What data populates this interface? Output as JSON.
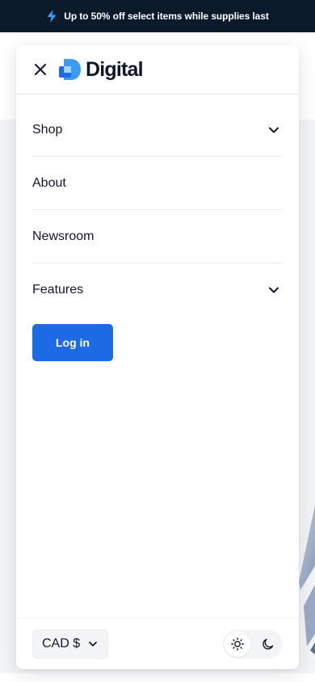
{
  "promo": {
    "icon": "lightning-bolt-icon",
    "text": "Up to 50% off select items while supplies last"
  },
  "header": {
    "brand": "Digital",
    "close_icon": "close-icon",
    "logo_icon": "digital-logo-icon"
  },
  "nav": {
    "items": [
      {
        "label": "Shop",
        "has_submenu": true
      },
      {
        "label": "About",
        "has_submenu": false
      },
      {
        "label": "Newsroom",
        "has_submenu": false
      },
      {
        "label": "Features",
        "has_submenu": true
      }
    ]
  },
  "actions": {
    "login_label": "Log in"
  },
  "footer": {
    "currency": "CAD $",
    "theme": {
      "light_icon": "sun-icon",
      "dark_icon": "moon-icon",
      "selected": "light"
    }
  },
  "colors": {
    "promo_bg": "#0b1a2b",
    "accent": "#1d6ae5",
    "brand_blue": "#3b9cf3"
  }
}
